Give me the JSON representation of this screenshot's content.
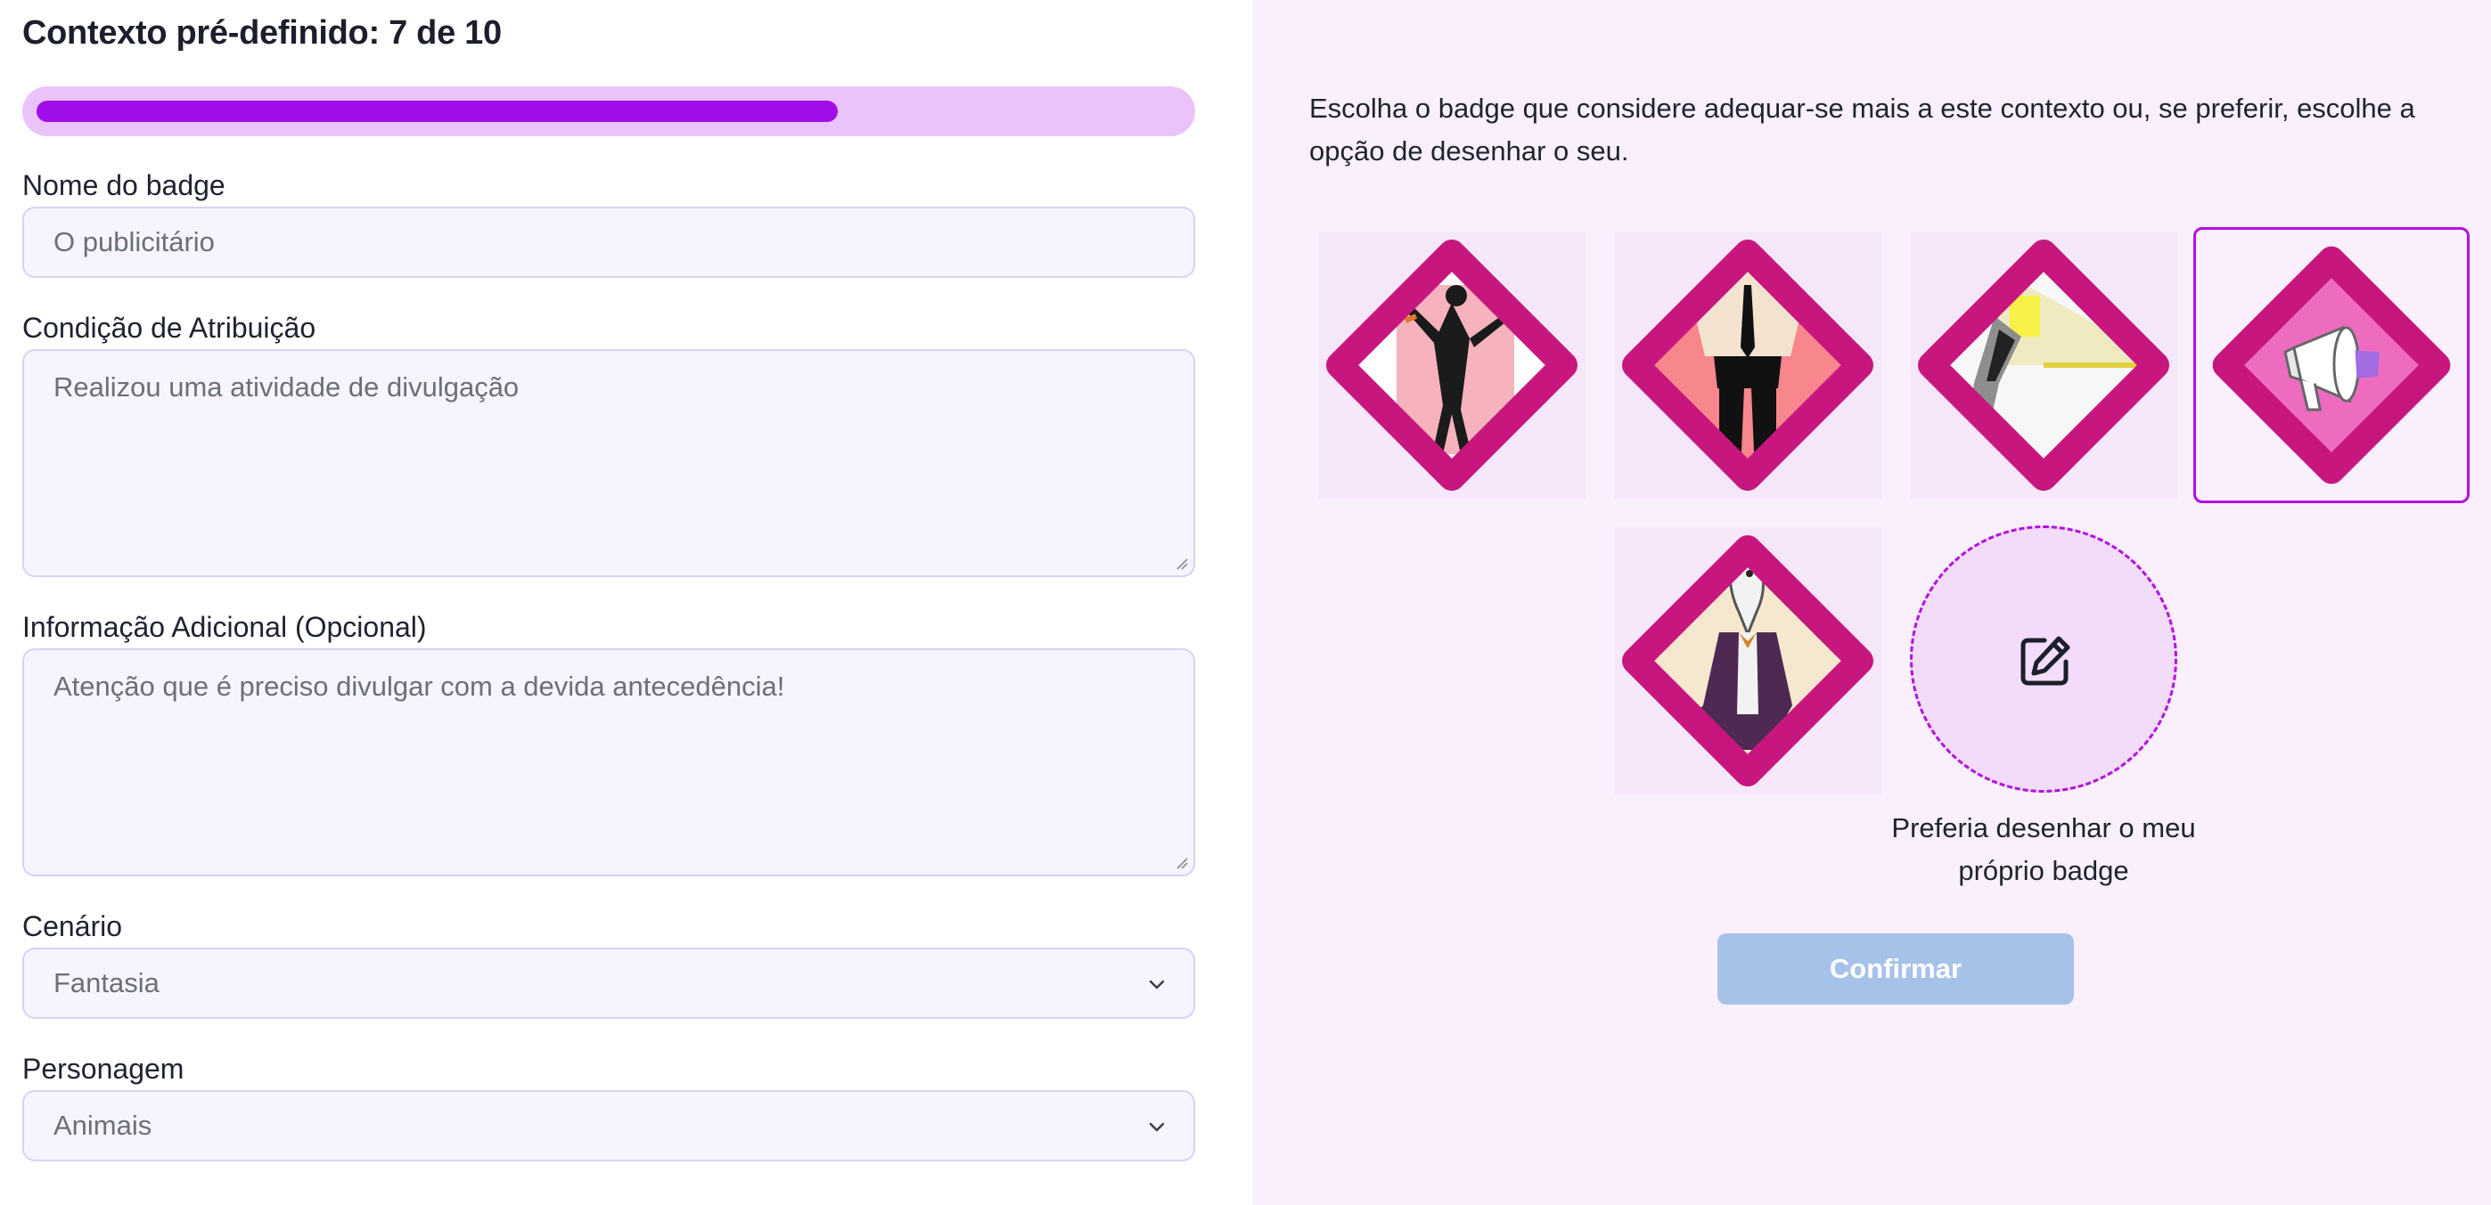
{
  "header": {
    "title": "Contexto pré-definido: 7 de 10",
    "progress": 0.7
  },
  "form": {
    "badge_name": {
      "label": "Nome do badge",
      "value": "O publicitário"
    },
    "condition": {
      "label": "Condição de Atribuição",
      "value": "Realizou uma atividade de divulgação"
    },
    "additional_info": {
      "label": "Informação Adicional (Opcional)",
      "value": "Atenção que é preciso divulgar com a devida antecedência!"
    },
    "scenario": {
      "label": "Cenário",
      "selected": "Fantasia"
    },
    "character": {
      "label": "Personagem",
      "selected": "Animais"
    }
  },
  "badge_picker": {
    "instructions": "Escolha o badge que considere adequar-se mais a este contexto ou, se preferir, escolhe a opção de desenhar o seu.",
    "badges": [
      {
        "icon": "celebrating-businessman-icon",
        "selected": false
      },
      {
        "icon": "businessman-icon",
        "selected": false
      },
      {
        "icon": "spotlight-icon",
        "selected": false
      },
      {
        "icon": "megaphone-icon",
        "selected": true
      },
      {
        "icon": "dressed-animal-icon",
        "selected": false
      }
    ],
    "draw_option": {
      "icon": "edit-icon",
      "caption": "Preferia desenhar o meu próprio badge"
    },
    "confirm_label": "Confirmar"
  },
  "colors": {
    "accent": "#a10ee9",
    "badge_frame": "#c7177e",
    "right_panel_bg": "#faf0fd",
    "confirm_disabled": "#a7c2e9"
  }
}
